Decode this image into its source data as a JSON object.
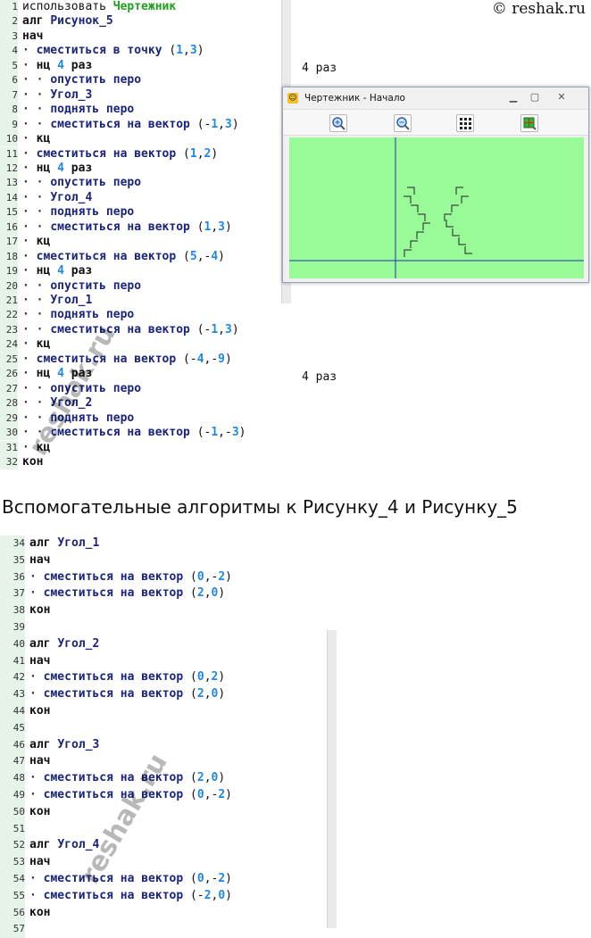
{
  "watermark": "© reshak.ru",
  "watermark_diagonal": "reshak.ru",
  "editor_top": {
    "lines": [
      {
        "n": "1",
        "tokens": [
          {
            "t": "использовать ",
            "c": "kw plain"
          },
          {
            "t": "Чертежник",
            "c": "green"
          }
        ]
      },
      {
        "n": "2",
        "tokens": [
          {
            "t": "алг ",
            "c": "kw"
          },
          {
            "t": "Рисунок_5",
            "c": "id"
          }
        ]
      },
      {
        "n": "3",
        "tokens": [
          {
            "t": "нач",
            "c": "kw"
          }
        ]
      },
      {
        "n": "4",
        "tokens": [
          {
            "t": "· ",
            "c": "dot"
          },
          {
            "t": "сместиться в точку ",
            "c": "id"
          },
          {
            "t": "(",
            "c": "plain"
          },
          {
            "t": "1",
            "c": "num"
          },
          {
            "t": ",",
            "c": "plain"
          },
          {
            "t": "3",
            "c": "num"
          },
          {
            "t": ")",
            "c": "plain"
          }
        ]
      },
      {
        "n": "5",
        "tokens": [
          {
            "t": "· ",
            "c": "dot"
          },
          {
            "t": "нц ",
            "c": "kw"
          },
          {
            "t": "4",
            "c": "num"
          },
          {
            "t": " раз",
            "c": "kw"
          }
        ]
      },
      {
        "n": "6",
        "tokens": [
          {
            "t": "· · ",
            "c": "dot"
          },
          {
            "t": "опустить перо",
            "c": "id"
          }
        ]
      },
      {
        "n": "7",
        "tokens": [
          {
            "t": "· · ",
            "c": "dot"
          },
          {
            "t": "Угол_3",
            "c": "id"
          }
        ]
      },
      {
        "n": "8",
        "tokens": [
          {
            "t": "· · ",
            "c": "dot"
          },
          {
            "t": "поднять перо",
            "c": "id"
          }
        ]
      },
      {
        "n": "9",
        "tokens": [
          {
            "t": "· · ",
            "c": "dot"
          },
          {
            "t": "сместиться на вектор ",
            "c": "id"
          },
          {
            "t": "(-",
            "c": "plain"
          },
          {
            "t": "1",
            "c": "num"
          },
          {
            "t": ",",
            "c": "plain"
          },
          {
            "t": "3",
            "c": "num"
          },
          {
            "t": ")",
            "c": "plain"
          }
        ]
      },
      {
        "n": "10",
        "tokens": [
          {
            "t": "· ",
            "c": "dot"
          },
          {
            "t": "кц",
            "c": "kw"
          }
        ]
      },
      {
        "n": "11",
        "tokens": [
          {
            "t": "· ",
            "c": "dot"
          },
          {
            "t": "сместиться на вектор ",
            "c": "id"
          },
          {
            "t": "(",
            "c": "plain"
          },
          {
            "t": "1",
            "c": "num"
          },
          {
            "t": ",",
            "c": "plain"
          },
          {
            "t": "2",
            "c": "num"
          },
          {
            "t": ")",
            "c": "plain"
          }
        ]
      },
      {
        "n": "12",
        "tokens": [
          {
            "t": "· ",
            "c": "dot"
          },
          {
            "t": "нц ",
            "c": "kw"
          },
          {
            "t": "4",
            "c": "num"
          },
          {
            "t": " раз",
            "c": "kw"
          }
        ]
      },
      {
        "n": "13",
        "tokens": [
          {
            "t": "· · ",
            "c": "dot"
          },
          {
            "t": "опустить перо",
            "c": "id"
          }
        ]
      },
      {
        "n": "14",
        "tokens": [
          {
            "t": "· · ",
            "c": "dot"
          },
          {
            "t": "Угол_4",
            "c": "id"
          }
        ]
      },
      {
        "n": "15",
        "tokens": [
          {
            "t": "· · ",
            "c": "dot"
          },
          {
            "t": "поднять перо",
            "c": "id"
          }
        ]
      },
      {
        "n": "16",
        "tokens": [
          {
            "t": "· · ",
            "c": "dot"
          },
          {
            "t": "сместиться на вектор ",
            "c": "id"
          },
          {
            "t": "(",
            "c": "plain"
          },
          {
            "t": "1",
            "c": "num"
          },
          {
            "t": ",",
            "c": "plain"
          },
          {
            "t": "3",
            "c": "num"
          },
          {
            "t": ")",
            "c": "plain"
          }
        ]
      },
      {
        "n": "17",
        "tokens": [
          {
            "t": "· ",
            "c": "dot"
          },
          {
            "t": "кц",
            "c": "kw"
          }
        ]
      },
      {
        "n": "18",
        "tokens": [
          {
            "t": "· ",
            "c": "dot"
          },
          {
            "t": "сместиться на вектор ",
            "c": "id"
          },
          {
            "t": "(",
            "c": "plain"
          },
          {
            "t": "5",
            "c": "num"
          },
          {
            "t": ",-",
            "c": "plain"
          },
          {
            "t": "4",
            "c": "num"
          },
          {
            "t": ")",
            "c": "plain"
          }
        ]
      },
      {
        "n": "19",
        "tokens": [
          {
            "t": "· ",
            "c": "dot"
          },
          {
            "t": "нц ",
            "c": "kw"
          },
          {
            "t": "4",
            "c": "num"
          },
          {
            "t": " раз",
            "c": "kw"
          }
        ]
      },
      {
        "n": "20",
        "tokens": [
          {
            "t": "· · ",
            "c": "dot"
          },
          {
            "t": "опустить перо",
            "c": "id"
          }
        ]
      },
      {
        "n": "21",
        "tokens": [
          {
            "t": "· · ",
            "c": "dot"
          },
          {
            "t": "Угол_1",
            "c": "id"
          }
        ]
      },
      {
        "n": "22",
        "tokens": [
          {
            "t": "· · ",
            "c": "dot"
          },
          {
            "t": "поднять перо",
            "c": "id"
          }
        ]
      },
      {
        "n": "23",
        "tokens": [
          {
            "t": "· · ",
            "c": "dot"
          },
          {
            "t": "сместиться на вектор ",
            "c": "id"
          },
          {
            "t": "(-",
            "c": "plain"
          },
          {
            "t": "1",
            "c": "num"
          },
          {
            "t": ",",
            "c": "plain"
          },
          {
            "t": "3",
            "c": "num"
          },
          {
            "t": ")",
            "c": "plain"
          }
        ]
      },
      {
        "n": "24",
        "tokens": [
          {
            "t": "· ",
            "c": "dot"
          },
          {
            "t": "кц",
            "c": "kw"
          }
        ]
      },
      {
        "n": "25",
        "tokens": [
          {
            "t": "· ",
            "c": "dot"
          },
          {
            "t": "сместиться на вектор ",
            "c": "id"
          },
          {
            "t": "(-",
            "c": "plain"
          },
          {
            "t": "4",
            "c": "num"
          },
          {
            "t": ",-",
            "c": "plain"
          },
          {
            "t": "9",
            "c": "num"
          },
          {
            "t": ")",
            "c": "plain"
          }
        ]
      },
      {
        "n": "26",
        "tokens": [
          {
            "t": "· ",
            "c": "dot"
          },
          {
            "t": "нц ",
            "c": "kw"
          },
          {
            "t": "4",
            "c": "num"
          },
          {
            "t": " раз",
            "c": "kw"
          }
        ]
      },
      {
        "n": "27",
        "tokens": [
          {
            "t": "· · ",
            "c": "dot"
          },
          {
            "t": "опустить перо",
            "c": "id"
          }
        ]
      },
      {
        "n": "28",
        "tokens": [
          {
            "t": "· · ",
            "c": "dot"
          },
          {
            "t": "Угол_2",
            "c": "id"
          }
        ]
      },
      {
        "n": "29",
        "tokens": [
          {
            "t": "· · ",
            "c": "dot"
          },
          {
            "t": "поднять перо",
            "c": "id"
          }
        ]
      },
      {
        "n": "30",
        "tokens": [
          {
            "t": "· · ",
            "c": "dot"
          },
          {
            "t": "сместиться на вектор ",
            "c": "id"
          },
          {
            "t": "(-",
            "c": "plain"
          },
          {
            "t": "1",
            "c": "num"
          },
          {
            "t": ",-",
            "c": "plain"
          },
          {
            "t": "3",
            "c": "num"
          },
          {
            "t": ")",
            "c": "plain"
          }
        ]
      },
      {
        "n": "31",
        "tokens": [
          {
            "t": "· ",
            "c": "dot"
          },
          {
            "t": "кц",
            "c": "kw"
          }
        ]
      },
      {
        "n": "32",
        "tokens": [
          {
            "t": "кон",
            "c": "kw"
          }
        ]
      }
    ],
    "notes": [
      "4 раз",
      "4 раз"
    ]
  },
  "heading": "Вспомогательные алгоритмы к Рисунку_4 и Рисунку_5",
  "editor_bottom": {
    "lines": [
      {
        "n": "34",
        "tokens": [
          {
            "t": "алг ",
            "c": "kw"
          },
          {
            "t": "Угол_1",
            "c": "id"
          }
        ]
      },
      {
        "n": "35",
        "tokens": [
          {
            "t": "нач",
            "c": "kw"
          }
        ]
      },
      {
        "n": "36",
        "tokens": [
          {
            "t": "· ",
            "c": "dot"
          },
          {
            "t": "сместиться на вектор ",
            "c": "id"
          },
          {
            "t": "(",
            "c": "plain"
          },
          {
            "t": "0",
            "c": "num"
          },
          {
            "t": ",-",
            "c": "plain"
          },
          {
            "t": "2",
            "c": "num"
          },
          {
            "t": ")",
            "c": "plain"
          }
        ]
      },
      {
        "n": "37",
        "tokens": [
          {
            "t": "· ",
            "c": "dot"
          },
          {
            "t": "сместиться на вектор ",
            "c": "id"
          },
          {
            "t": "(",
            "c": "plain"
          },
          {
            "t": "2",
            "c": "num"
          },
          {
            "t": ",",
            "c": "plain"
          },
          {
            "t": "0",
            "c": "num"
          },
          {
            "t": ")",
            "c": "plain"
          }
        ]
      },
      {
        "n": "38",
        "tokens": [
          {
            "t": "кон",
            "c": "kw"
          }
        ]
      },
      {
        "n": "39",
        "tokens": []
      },
      {
        "n": "40",
        "tokens": [
          {
            "t": "алг ",
            "c": "kw"
          },
          {
            "t": "Угол_2",
            "c": "id"
          }
        ]
      },
      {
        "n": "41",
        "tokens": [
          {
            "t": "нач",
            "c": "kw"
          }
        ]
      },
      {
        "n": "42",
        "tokens": [
          {
            "t": "· ",
            "c": "dot"
          },
          {
            "t": "сместиться на вектор ",
            "c": "id"
          },
          {
            "t": "(",
            "c": "plain"
          },
          {
            "t": "0",
            "c": "num"
          },
          {
            "t": ",",
            "c": "plain"
          },
          {
            "t": "2",
            "c": "num"
          },
          {
            "t": ")",
            "c": "plain"
          }
        ]
      },
      {
        "n": "43",
        "tokens": [
          {
            "t": "· ",
            "c": "dot"
          },
          {
            "t": "сместиться на вектор ",
            "c": "id"
          },
          {
            "t": "(",
            "c": "plain"
          },
          {
            "t": "2",
            "c": "num"
          },
          {
            "t": ",",
            "c": "plain"
          },
          {
            "t": "0",
            "c": "num"
          },
          {
            "t": ")",
            "c": "plain"
          }
        ]
      },
      {
        "n": "44",
        "tokens": [
          {
            "t": "кон",
            "c": "kw"
          }
        ]
      },
      {
        "n": "45",
        "tokens": []
      },
      {
        "n": "46",
        "tokens": [
          {
            "t": "алг ",
            "c": "kw"
          },
          {
            "t": "Угол_3",
            "c": "id"
          }
        ]
      },
      {
        "n": "47",
        "tokens": [
          {
            "t": "нач",
            "c": "kw"
          }
        ]
      },
      {
        "n": "48",
        "tokens": [
          {
            "t": "· ",
            "c": "dot"
          },
          {
            "t": "сместиться на вектор ",
            "c": "id"
          },
          {
            "t": "(",
            "c": "plain"
          },
          {
            "t": "2",
            "c": "num"
          },
          {
            "t": ",",
            "c": "plain"
          },
          {
            "t": "0",
            "c": "num"
          },
          {
            "t": ")",
            "c": "plain"
          }
        ]
      },
      {
        "n": "49",
        "tokens": [
          {
            "t": "· ",
            "c": "dot"
          },
          {
            "t": "сместиться на вектор ",
            "c": "id"
          },
          {
            "t": "(",
            "c": "plain"
          },
          {
            "t": "0",
            "c": "num"
          },
          {
            "t": ",-",
            "c": "plain"
          },
          {
            "t": "2",
            "c": "num"
          },
          {
            "t": ")",
            "c": "plain"
          }
        ]
      },
      {
        "n": "50",
        "tokens": [
          {
            "t": "кон",
            "c": "kw"
          }
        ]
      },
      {
        "n": "51",
        "tokens": []
      },
      {
        "n": "52",
        "tokens": [
          {
            "t": "алг ",
            "c": "kw"
          },
          {
            "t": "Угол_4",
            "c": "id"
          }
        ]
      },
      {
        "n": "53",
        "tokens": [
          {
            "t": "нач",
            "c": "kw"
          }
        ]
      },
      {
        "n": "54",
        "tokens": [
          {
            "t": "· ",
            "c": "dot"
          },
          {
            "t": "сместиться на вектор ",
            "c": "id"
          },
          {
            "t": "(",
            "c": "plain"
          },
          {
            "t": "0",
            "c": "num"
          },
          {
            "t": ",-",
            "c": "plain"
          },
          {
            "t": "2",
            "c": "num"
          },
          {
            "t": ")",
            "c": "plain"
          }
        ]
      },
      {
        "n": "55",
        "tokens": [
          {
            "t": "· ",
            "c": "dot"
          },
          {
            "t": "сместиться на вектор ",
            "c": "id"
          },
          {
            "t": "(-",
            "c": "plain"
          },
          {
            "t": "2",
            "c": "num"
          },
          {
            "t": ",",
            "c": "plain"
          },
          {
            "t": "0",
            "c": "num"
          },
          {
            "t": ")",
            "c": "plain"
          }
        ]
      },
      {
        "n": "56",
        "tokens": [
          {
            "t": "кон",
            "c": "kw"
          }
        ]
      },
      {
        "n": "57",
        "tokens": []
      }
    ]
  },
  "drawer_window": {
    "title": "Чертежник - Начало",
    "toolbar_icons": [
      "zoom-in-icon",
      "zoom-out-icon",
      "grid-icon",
      "fit-icon"
    ],
    "canvas_color": "#98fb98",
    "axis_color": "#2233aa"
  }
}
